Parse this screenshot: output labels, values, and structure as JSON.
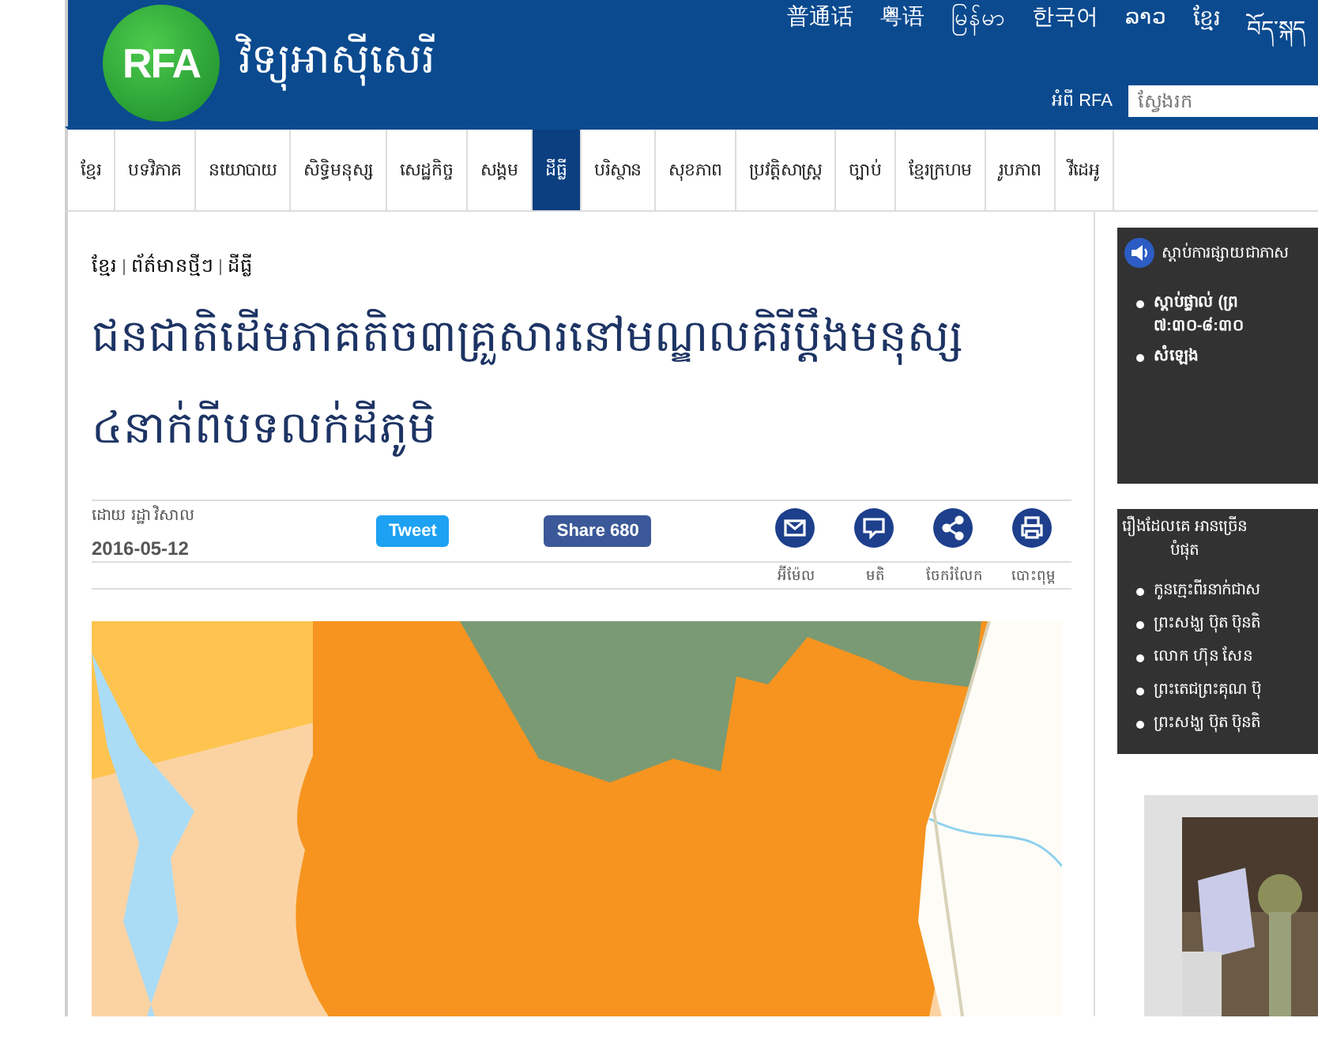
{
  "header": {
    "logo": "RFA",
    "site_title": "វិទ្យុអាស៊ីសេរី",
    "languages": [
      "普通话",
      "粤语",
      "မြန်မာ",
      "한국어",
      "ລາວ",
      "ខ្មែរ",
      "བོད་སྐད"
    ],
    "about_link": "អំពី RFA",
    "search": {
      "placeholder": "ស្វែងរក"
    }
  },
  "nav": [
    {
      "label": "ខ្មែរ",
      "selected": false
    },
    {
      "label": "បទវិភាគ",
      "selected": false
    },
    {
      "label": "នយោបាយ",
      "selected": false
    },
    {
      "label": "សិទ្ធិមនុស្ស",
      "selected": false
    },
    {
      "label": "សេដ្ឋកិច្ច",
      "selected": false
    },
    {
      "label": "សង្គម",
      "selected": false
    },
    {
      "label": "ដីធ្លី",
      "selected": true
    },
    {
      "label": "បរិស្ថាន",
      "selected": false
    },
    {
      "label": "សុខភាព",
      "selected": false
    },
    {
      "label": "ប្រវត្តិសាស្ត្រ",
      "selected": false
    },
    {
      "label": "ច្បាប់",
      "selected": false
    },
    {
      "label": "ខ្មែរក្រហម",
      "selected": false
    },
    {
      "label": "រូបភាព",
      "selected": false
    },
    {
      "label": "វីដេអូ",
      "selected": false
    }
  ],
  "article": {
    "breadcrumb": [
      "ខ្មែរ",
      "ព័ត៌មានថ្មីៗ",
      "ដីធ្លី"
    ],
    "title": "ជនជាតិដើមភាគតិច៣គ្រួសារនៅមណ្ឌលគិរីប្ដឹងមនុស្ស ៤នាក់ពីបទលក់ដីភូមិ",
    "byline": "ដោយ រដ្ឋា វិសាល",
    "date": "2016-05-12",
    "tweet": "Tweet",
    "share": "Share 680",
    "tools": [
      {
        "kind": "email",
        "label": "អ៊ីម៉ែល"
      },
      {
        "kind": "comment",
        "label": "មតិ"
      },
      {
        "kind": "share",
        "label": "ចែករំលែក"
      },
      {
        "kind": "print",
        "label": "បោះពុម្ព"
      }
    ],
    "image": {
      "kind": "picture"
    }
  },
  "sidebar": {
    "listen": {
      "title": "ស្តាប់ការផ្សាយជាភាស",
      "items": [
        "ស្តាប់ផ្ទាល់ (ព្រ ៧:៣០-៨:៣០",
        "សំឡេង"
      ]
    },
    "most_read": {
      "title": "រឿងដែលគេ អានច្រើនបំផុត",
      "items": [
        "កូនក្មេះពីរនាក់ជាស",
        "ព្រះសង្ឃ ប៊ុត ប៊ុនតិ",
        "លោក ហ៊ុន សែន",
        "ព្រះតេជព្រះគុណ ប៊ុ",
        "ព្រះសង្ឃ ប៊ុត ប៊ុនតិ"
      ]
    },
    "photo": {
      "kind": "picture"
    }
  }
}
